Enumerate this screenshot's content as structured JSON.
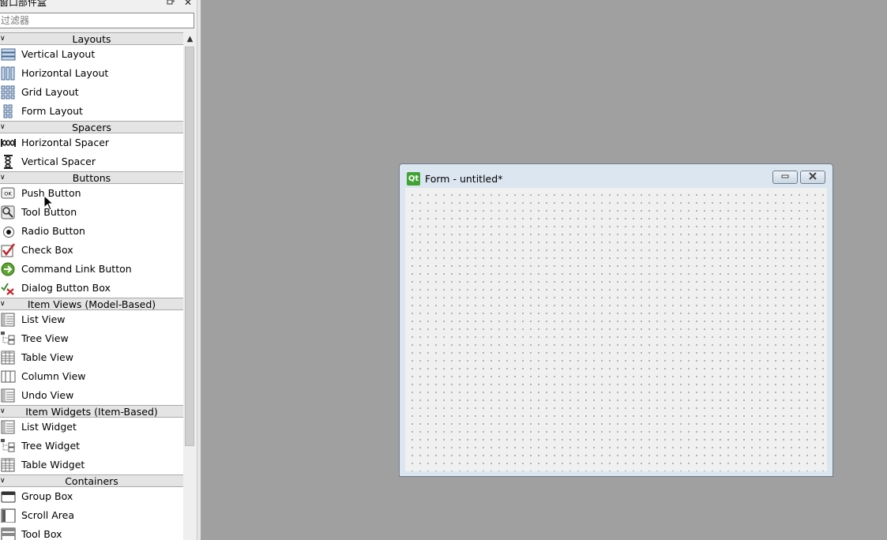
{
  "widget_box": {
    "title": "窗口部件盒",
    "float_icon": "float-icon",
    "close_icon": "close-icon",
    "filter_placeholder": "过滤器",
    "categories": [
      {
        "label": "Layouts",
        "items": [
          {
            "label": "Vertical Layout",
            "icon": "vertical-layout-icon"
          },
          {
            "label": "Horizontal Layout",
            "icon": "horizontal-layout-icon"
          },
          {
            "label": "Grid Layout",
            "icon": "grid-layout-icon"
          },
          {
            "label": "Form Layout",
            "icon": "form-layout-icon"
          }
        ]
      },
      {
        "label": "Spacers",
        "items": [
          {
            "label": "Horizontal Spacer",
            "icon": "horizontal-spacer-icon"
          },
          {
            "label": "Vertical Spacer",
            "icon": "vertical-spacer-icon"
          }
        ]
      },
      {
        "label": "Buttons",
        "items": [
          {
            "label": "Push Button",
            "icon": "push-button-icon"
          },
          {
            "label": "Tool Button",
            "icon": "tool-button-icon"
          },
          {
            "label": "Radio Button",
            "icon": "radio-button-icon"
          },
          {
            "label": "Check Box",
            "icon": "check-box-icon"
          },
          {
            "label": "Command Link Button",
            "icon": "command-link-icon"
          },
          {
            "label": "Dialog Button Box",
            "icon": "dialog-button-box-icon"
          }
        ]
      },
      {
        "label": "Item Views (Model-Based)",
        "items": [
          {
            "label": "List View",
            "icon": "list-view-icon"
          },
          {
            "label": "Tree View",
            "icon": "tree-view-icon"
          },
          {
            "label": "Table View",
            "icon": "table-view-icon"
          },
          {
            "label": "Column View",
            "icon": "column-view-icon"
          },
          {
            "label": "Undo View",
            "icon": "undo-view-icon"
          }
        ]
      },
      {
        "label": "Item Widgets (Item-Based)",
        "items": [
          {
            "label": "List Widget",
            "icon": "list-widget-icon"
          },
          {
            "label": "Tree Widget",
            "icon": "tree-widget-icon"
          },
          {
            "label": "Table Widget",
            "icon": "table-widget-icon"
          }
        ]
      },
      {
        "label": "Containers",
        "items": [
          {
            "label": "Group Box",
            "icon": "group-box-icon"
          },
          {
            "label": "Scroll Area",
            "icon": "scroll-area-icon"
          },
          {
            "label": "Tool Box",
            "icon": "tool-box-icon"
          }
        ]
      }
    ]
  },
  "form_window": {
    "title": "Form - untitled*",
    "logo_text": "Qt",
    "minimize_icon": "minimize-icon",
    "close_icon": "close-icon"
  },
  "colors": {
    "workspace": "#a0a0a0",
    "category_bg": "#e4e4e4",
    "qt_green": "#41a334",
    "form_frame": "#dbe6f1"
  }
}
